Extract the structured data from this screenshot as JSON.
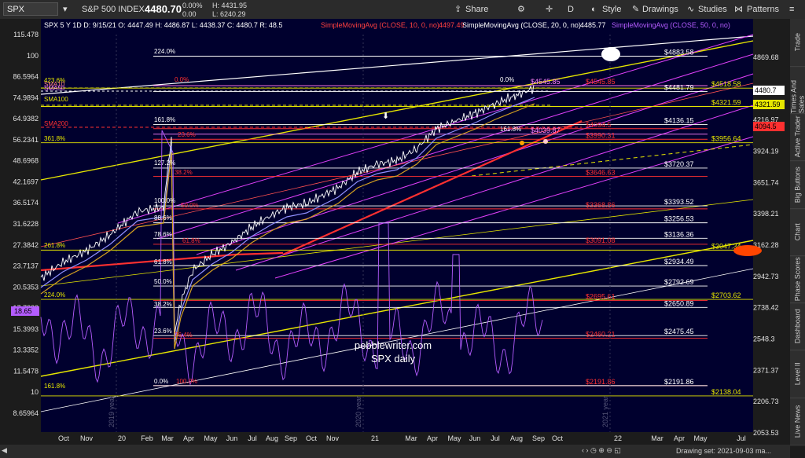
{
  "topbar": {
    "symbol": "SPX",
    "index_name": "S&P 500 INDEX",
    "last_price": "4480.70",
    "change": "0.00%",
    "change_abs": "0.00",
    "hi": "H: 4431.95",
    "lo": "L: 6240.29",
    "share": "Share",
    "interval": "D",
    "style": "Style",
    "drawings": "Drawings",
    "studies": "Studies",
    "patterns": "Patterns"
  },
  "legend": {
    "ohlc": "SPX 5 Y 1D  D: 9/15/21  O: 4447.49  H: 4486.87  L: 4438.37  C: 4480.7  R: 48.5",
    "sma10": "SimpleMovingAvg (CLOSE, 10, 0, no)",
    "sma10_val": "4497.49",
    "sma20": "SimpleMovingAvg (CLOSE, 20, 0, no)",
    "sma20_val": "4485.77",
    "sma50": "SimpleMovingAvg (CLOSE, 50, 0, no)"
  },
  "rightbar": [
    "Trade",
    "Times And Sales",
    "Active Trader",
    "Big Buttons",
    "Chart",
    "Phase Scores",
    "Dashboard",
    "Level II",
    "Live News"
  ],
  "bottombar": {
    "drawing_set": "Drawing set: 2021-09-03 ma..."
  },
  "watermark": {
    "line1": "pebblewriter.com",
    "line2": "SPX daily"
  },
  "colors": {
    "background": "#00002e",
    "price": "#ffffff",
    "rsi": "#b45cff",
    "fib_pink": "#e040fb",
    "yellow": "#e6e600",
    "red": "#ff3030",
    "orange": "#ffa500"
  },
  "chart_data": {
    "type": "line",
    "log_scale": true,
    "ylim": [
      8.65964,
      125
    ],
    "y_ticks": [
      "115.478",
      "100",
      "86.5964",
      "74.9894",
      "64.9382",
      "56.2341",
      "48.6968",
      "42.1697",
      "36.5174",
      "31.6228",
      "27.3842",
      "23.7137",
      "20.5353",
      "17.7828",
      "15.3993",
      "13.3352",
      "11.5478",
      "10",
      "8.65964"
    ],
    "x_ticks": [
      "Oct",
      "Nov",
      "20",
      "Feb",
      "Mar",
      "Apr",
      "May",
      "Jun",
      "Jul",
      "Aug",
      "Sep",
      "Oct",
      "Nov",
      "21",
      "Mar",
      "Apr",
      "May",
      "Jun",
      "Jul",
      "Aug",
      "Sep",
      "Oct",
      "22",
      "Mar",
      "Apr",
      "May",
      "Jul"
    ],
    "year_markers": [
      "2019 year",
      "2020 year",
      "2021 year"
    ],
    "right_axis": [
      "4869.68",
      "4521.58",
      "4216.97",
      "3924.19",
      "3651.74",
      "3398.21",
      "3162.28",
      "2942.73",
      "2738.42",
      "2548.3",
      "2371.37",
      "2206.73",
      "2053.53"
    ],
    "price_badges": [
      {
        "text": "4480.7",
        "color": "#ffffff"
      },
      {
        "text": "4321.59",
        "color": "#e6e600"
      },
      {
        "text": "4094.5",
        "color": "#ff3030"
      }
    ],
    "left_badges": [
      {
        "text": "18.65",
        "color": "#b45cff"
      }
    ],
    "left_fib_labels": [
      {
        "text": "423.6%",
        "color": "#e6e600"
      },
      {
        "text": "SMA10",
        "color": "#ff8080"
      },
      {
        "text": "SMA50",
        "color": "#ff80ff"
      },
      {
        "text": "SMA100",
        "color": "#e6e600"
      },
      {
        "text": "SMA200",
        "color": "#ff3030"
      },
      {
        "text": "361.8%",
        "color": "#e6e600"
      },
      {
        "text": "261.8%",
        "color": "#e6e600"
      },
      {
        "text": "224.0%",
        "color": "#e6e600"
      },
      {
        "text": "161.8%",
        "color": "#e6e600"
      }
    ],
    "inner_fib_labels": [
      {
        "text": "224.0%",
        "color": "#ffffff"
      },
      {
        "text": "0.0%",
        "color": "#ff3030"
      },
      {
        "text": "161.8%",
        "color": "#ffffff"
      },
      {
        "text": "23.6%",
        "color": "#ff3030"
      },
      {
        "text": "127.2%",
        "color": "#ffffff"
      },
      {
        "text": "38.2%",
        "color": "#ff3030"
      },
      {
        "text": "100.0%",
        "color": "#ffffff"
      },
      {
        "text": "50.0%",
        "color": "#ff3030"
      },
      {
        "text": "88.6%",
        "color": "#ffffff"
      },
      {
        "text": "78.6%",
        "color": "#ffffff"
      },
      {
        "text": "61.8%",
        "color": "#ff3030"
      },
      {
        "text": "61.8%",
        "color": "#ffffff"
      },
      {
        "text": "50.0%",
        "color": "#ffffff"
      },
      {
        "text": "38.2%",
        "color": "#ffffff"
      },
      {
        "text": "23.6%",
        "color": "#ffffff"
      },
      {
        "text": "76.4%",
        "color": "#ff3030"
      },
      {
        "text": "0.0%",
        "color": "#ffffff"
      },
      {
        "text": "100.0%",
        "color": "#ff3030"
      },
      {
        "text": "0.0%",
        "color": "#ffffff"
      },
      {
        "text": "161.8%",
        "color": "#ffffff"
      }
    ],
    "levels": [
      {
        "label": "$4883.58",
        "value": 4883.58,
        "color": "#ffffff"
      },
      {
        "label": "$4545.85",
        "value": 4545.85,
        "color": "#ff3030"
      },
      {
        "label": "$4545.85",
        "value": 4545.85,
        "color": "#ff80ff"
      },
      {
        "label": "$4518.58",
        "value": 4518.58,
        "color": "#e6e600"
      },
      {
        "label": "$4481.79",
        "value": 4481.79,
        "color": "#ffffff"
      },
      {
        "label": "$4321.59",
        "value": 4321.59,
        "color": "#e6e600"
      },
      {
        "label": "$4136.15",
        "value": 4136.15,
        "color": "#ffffff"
      },
      {
        "label": "$4094.5",
        "value": 4094.5,
        "color": "#ff3030"
      },
      {
        "label": "$4039.87",
        "value": 4039.87,
        "color": "#ff80ff"
      },
      {
        "label": "$3990.31",
        "value": 3990.31,
        "color": "#ff3030"
      },
      {
        "label": "$3956.64",
        "value": 3956.64,
        "color": "#e6e600"
      },
      {
        "label": "$3720.37",
        "value": 3720.37,
        "color": "#ffffff"
      },
      {
        "label": "$3646.63",
        "value": 3646.63,
        "color": "#ff3030"
      },
      {
        "label": "$3393.52",
        "value": 3393.52,
        "color": "#ffffff"
      },
      {
        "label": "$3368.86",
        "value": 3368.86,
        "color": "#ff3030"
      },
      {
        "label": "$3256.53",
        "value": 3256.53,
        "color": "#ffffff"
      },
      {
        "label": "$3136.36",
        "value": 3136.36,
        "color": "#ffffff"
      },
      {
        "label": "$3091.08",
        "value": 3091.08,
        "color": "#ff3030"
      },
      {
        "label": "$3047.34",
        "value": 3047.34,
        "color": "#e6e600"
      },
      {
        "label": "$2934.49",
        "value": 2934.49,
        "color": "#ffffff"
      },
      {
        "label": "$2792.69",
        "value": 2792.69,
        "color": "#ffffff"
      },
      {
        "label": "$2703.62",
        "value": 2703.62,
        "color": "#e6e600"
      },
      {
        "label": "$2695.61",
        "value": 2695.61,
        "color": "#ff3030"
      },
      {
        "label": "$2650.89",
        "value": 2650.89,
        "color": "#ffffff"
      },
      {
        "label": "$2475.45",
        "value": 2475.45,
        "color": "#ffffff"
      },
      {
        "label": "$2460.21",
        "value": 2460.21,
        "color": "#ff3030"
      },
      {
        "label": "$2191.86",
        "value": 2191.86,
        "color": "#ff3030"
      },
      {
        "label": "$2191.86",
        "value": 2191.86,
        "color": "#ffffff"
      },
      {
        "label": "$2138.04",
        "value": 2138.04,
        "color": "#e6e600"
      }
    ]
  }
}
